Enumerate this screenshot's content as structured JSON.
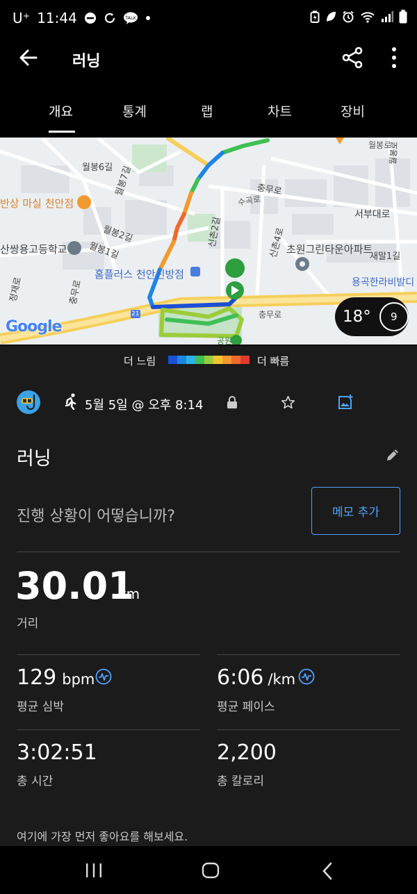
{
  "status": {
    "carrier": "U⁺",
    "time": "11:44"
  },
  "header": {
    "title": "러닝"
  },
  "tabs": [
    "개요",
    "통계",
    "랩",
    "차트",
    "장비"
  ],
  "map": {
    "labels": {
      "wolbong_ro": "월봉로",
      "wolbong6": "월봉6길",
      "wolbong7": "월봉7길",
      "wolbong2": "월봉2길",
      "wolbong1": "월봉1길",
      "chungmu_ro": "충무로",
      "chungmu_ro2": "충무로",
      "chungmu_ro3": "충무로",
      "suko_ro": "수곡로",
      "sinchon2": "신촌2길",
      "sinchon4": "신촌4로",
      "restaurant": "반상 마실 천안점",
      "school": "산쌍용고등학교",
      "homeplus": "홈플러스 천안신방점",
      "apartment": "초원그린타운아파트",
      "seobudae": "서부대로",
      "saemal": "새말1길",
      "yonggok": "용곡한라비발디",
      "jeongjae": "정재로",
      "park": "공원",
      "route21": "21",
      "weather_temp": "18°",
      "weather_num": "9",
      "wolbong_vertical": "월봉로",
      "google": "Google"
    },
    "legend_slow": "더 느림",
    "legend_fast": "더 빠름",
    "legend_colors": [
      "#1a4fd6",
      "#1d86e4",
      "#2fb3e6",
      "#3fbf55",
      "#9ccc3a",
      "#f4c430",
      "#f29a2e",
      "#ef6a2c",
      "#e23b2e"
    ]
  },
  "activity": {
    "date": "5월 5일 @ 오후 8:14",
    "name": "러닝",
    "question": "진행 상황이 어떻습니까?",
    "add_note": "메모 추가"
  },
  "stats": {
    "distance_value": "30.01",
    "distance_unit": "km",
    "distance_label": "거리",
    "hr_value": "129",
    "hr_unit": "bpm",
    "hr_label": "평균 심박",
    "pace_value": "6:06",
    "pace_unit": "/km",
    "pace_label": "평균 페이스",
    "time_value": "3:02:51",
    "time_label": "총 시간",
    "cal_value": "2,200",
    "cal_label": "총 칼로리"
  },
  "footer_text": "여기에 가장 먼저 좋아요를 해보세요.",
  "colors": {
    "accent": "#4fa3ff",
    "background": "#1b1b1b"
  }
}
